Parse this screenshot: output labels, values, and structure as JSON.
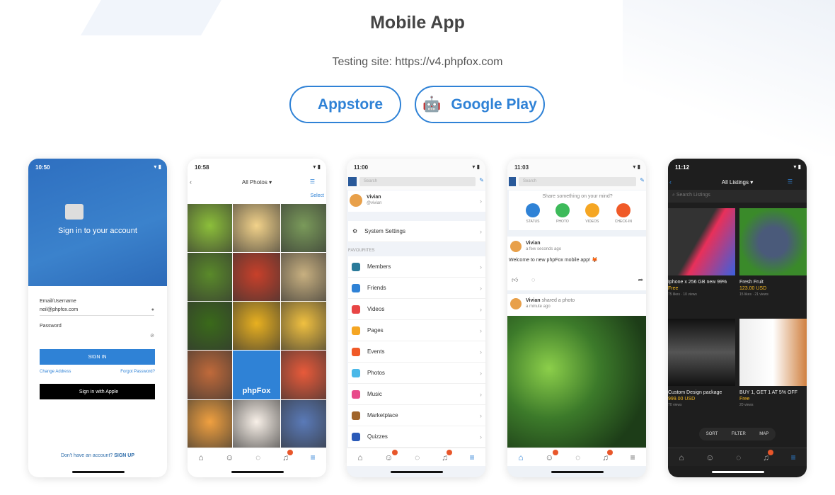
{
  "title": "Mobile App",
  "testing_site": "Testing site: https://v4.phpfox.com",
  "buttons": {
    "appstore": "Appstore",
    "google_play": "Google Play"
  },
  "accent": "#2f82d6",
  "phone1": {
    "time": "10:50",
    "heading": "Sign in to your account",
    "email_label": "Email/Username",
    "email_value": "neil@phpfox.com",
    "password_label": "Password",
    "signin": "SIGN IN",
    "change_address": "Change Address",
    "forgot": "Forgot Password?",
    "apple": "Sign in with Apple",
    "no_account": "Don't have an account?",
    "signup": "SIGN UP"
  },
  "phone2": {
    "time": "10:58",
    "title": "All Photos ▾",
    "select": "Select",
    "logo_text": "phpFox"
  },
  "phone3": {
    "time": "11:00",
    "search_placeholder": "Search",
    "user_name": "Vivian",
    "user_handle": "@vivian",
    "system_settings": "System Settings",
    "favourites": "FAVOURITES",
    "items": [
      {
        "label": "Members",
        "color": "#2a7a9a"
      },
      {
        "label": "Friends",
        "color": "#2f82d6"
      },
      {
        "label": "Videos",
        "color": "#e84545"
      },
      {
        "label": "Pages",
        "color": "#f5a623"
      },
      {
        "label": "Events",
        "color": "#f05a28"
      },
      {
        "label": "Photos",
        "color": "#4ab8e8"
      },
      {
        "label": "Music",
        "color": "#e84a8a"
      },
      {
        "label": "Marketplace",
        "color": "#a0642a"
      },
      {
        "label": "Quizzes",
        "color": "#2a5ab8"
      }
    ]
  },
  "phone4": {
    "time": "11:03",
    "search_placeholder": "Search",
    "share_prompt": "Share something on your mind?",
    "actions": [
      {
        "label": "STATUS",
        "color": "#2f82d6"
      },
      {
        "label": "PHOTO",
        "color": "#3dba5a"
      },
      {
        "label": "VIDEOS",
        "color": "#f5a623"
      },
      {
        "label": "CHECK-IN",
        "color": "#f05a28"
      }
    ],
    "post1": {
      "author": "Vivian",
      "time": "a few seconds ago",
      "text": "Welcome to new phpFox mobile app! 🦊"
    },
    "post2": {
      "author": "Vivian",
      "action": "shared a photo",
      "time": "a minute ago"
    }
  },
  "phone5": {
    "time": "11:12",
    "title": "All Listings ▾",
    "search_placeholder": "Search Listings",
    "listings": [
      {
        "title": "Iphone x 256 GB new 99%",
        "price": "Free",
        "meta": "75 likes · 10 views"
      },
      {
        "title": "Fresh Fruit",
        "price": "123.00 USD",
        "meta": "15 likes · 21 views"
      },
      {
        "title": "Custom Design package",
        "price": "999.00 USD",
        "meta": "70 views"
      },
      {
        "title": "BUY 1, GET 1 AT 5% OFF",
        "price": "Free",
        "meta": "20 views"
      }
    ],
    "sort": "SORT",
    "filter": "FILTER",
    "map": "MAP"
  },
  "badge_color": "#e8562a"
}
